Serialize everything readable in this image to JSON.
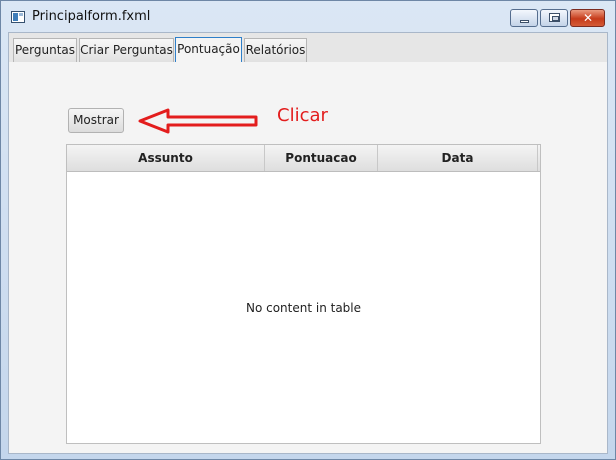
{
  "window": {
    "title": "Principalform.fxml",
    "controls": {
      "minimize": "minimize-icon",
      "maximize": "maximize-icon",
      "close": "close-icon"
    }
  },
  "tabs": [
    {
      "label": "Perguntas"
    },
    {
      "label": "Criar Perguntas"
    },
    {
      "label": "Pontuação",
      "active": true
    },
    {
      "label": "Relatórios"
    }
  ],
  "toolbar": {
    "show_label": "Mostrar"
  },
  "annotation": {
    "text": "Clicar",
    "color": "#e31d1d"
  },
  "table": {
    "columns": [
      "Assunto",
      "Pontuacao",
      "Data"
    ],
    "empty_text": "No content in table"
  },
  "colors": {
    "accent": "#2e7fc9",
    "annotation_red": "#e31d1d"
  }
}
